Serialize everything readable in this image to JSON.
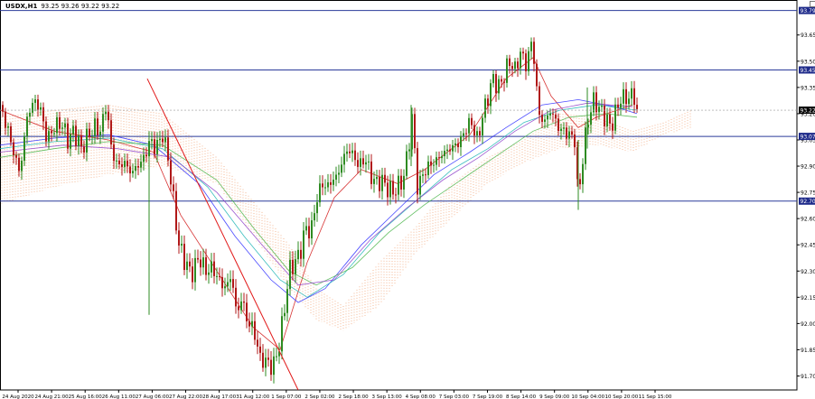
{
  "header": {
    "symbol": "USDX,H1",
    "ohlc": "93.25 93.26 93.22 93.22"
  },
  "chart_data": {
    "type": "candlestick",
    "symbol": "USDX",
    "timeframe": "H1",
    "ylim": [
      91.62,
      93.85
    ],
    "y_ticks": [
      "93.65",
      "93.50",
      "93.35",
      "93.20",
      "93.05",
      "92.90",
      "92.75",
      "92.60",
      "92.45",
      "92.30",
      "92.15",
      "92.00",
      "91.85",
      "91.70"
    ],
    "x_ticks": [
      "24 Aug 2020",
      "24 Aug 21:00",
      "25 Aug 16:00",
      "26 Aug 11:00",
      "27 Aug 06:00",
      "27 Aug 22:00",
      "28 Aug 17:00",
      "31 Aug 12:00",
      "1 Sep 07:00",
      "2 Sep 02:00",
      "2 Sep 18:00",
      "3 Sep 13:00",
      "4 Sep 08:00",
      "7 Sep 03:00",
      "7 Sep 19:00",
      "8 Sep 14:00",
      "9 Sep 09:00",
      "10 Sep 04:00",
      "10 Sep 20:00",
      "11 Sep 15:00"
    ],
    "horizontal_levels": [
      {
        "value": 93.79,
        "label": "93.79"
      },
      {
        "value": 93.45,
        "label": "93.45"
      },
      {
        "value": 93.07,
        "label": "93.07"
      },
      {
        "value": 92.7,
        "label": "92.70"
      }
    ],
    "current_price": {
      "value": 93.22,
      "label": "93.22"
    },
    "trendline": {
      "from": [
        163,
        93.4
      ],
      "to": [
        330,
        91.62
      ]
    },
    "price_path": [
      [
        0,
        93.25
      ],
      [
        8,
        93.12
      ],
      [
        15,
        92.98
      ],
      [
        22,
        92.86
      ],
      [
        30,
        93.18
      ],
      [
        38,
        93.28
      ],
      [
        45,
        93.22
      ],
      [
        52,
        93.05
      ],
      [
        60,
        93.12
      ],
      [
        68,
        93.15
      ],
      [
        75,
        93.05
      ],
      [
        82,
        93.1
      ],
      [
        90,
        93.0
      ],
      [
        98,
        93.08
      ],
      [
        105,
        93.12
      ],
      [
        112,
        93.1
      ],
      [
        118,
        93.28
      ],
      [
        122,
        93.02
      ],
      [
        130,
        92.9
      ],
      [
        138,
        92.92
      ],
      [
        145,
        92.86
      ],
      [
        152,
        92.9
      ],
      [
        160,
        92.95
      ],
      [
        166,
        93.05
      ],
      [
        172,
        93.0
      ],
      [
        180,
        93.08
      ],
      [
        186,
        92.95
      ],
      [
        192,
        92.7
      ],
      [
        198,
        92.45
      ],
      [
        205,
        92.35
      ],
      [
        212,
        92.28
      ],
      [
        220,
        92.38
      ],
      [
        228,
        92.3
      ],
      [
        235,
        92.32
      ],
      [
        242,
        92.25
      ],
      [
        250,
        92.2
      ],
      [
        256,
        92.28
      ],
      [
        262,
        92.05
      ],
      [
        268,
        92.15
      ],
      [
        274,
        92.0
      ],
      [
        280,
        91.98
      ],
      [
        288,
        91.8
      ],
      [
        295,
        91.78
      ],
      [
        302,
        91.75
      ],
      [
        308,
        91.85
      ],
      [
        314,
        92.05
      ],
      [
        320,
        92.3
      ],
      [
        326,
        92.35
      ],
      [
        332,
        92.4
      ],
      [
        338,
        92.55
      ],
      [
        344,
        92.52
      ],
      [
        350,
        92.7
      ],
      [
        356,
        92.8
      ],
      [
        362,
        92.78
      ],
      [
        368,
        92.82
      ],
      [
        374,
        92.85
      ],
      [
        380,
        92.95
      ],
      [
        386,
        93.0
      ],
      [
        392,
        92.95
      ],
      [
        398,
        92.9
      ],
      [
        404,
        92.95
      ],
      [
        410,
        92.85
      ],
      [
        416,
        92.8
      ],
      [
        422,
        92.82
      ],
      [
        428,
        92.78
      ],
      [
        434,
        92.75
      ],
      [
        440,
        92.78
      ],
      [
        446,
        92.82
      ],
      [
        452,
        93.0
      ],
      [
        456,
        93.18
      ],
      [
        462,
        92.78
      ],
      [
        468,
        92.85
      ],
      [
        474,
        92.9
      ],
      [
        480,
        92.92
      ],
      [
        486,
        92.95
      ],
      [
        492,
        92.98
      ],
      [
        498,
        93.0
      ],
      [
        504,
        93.02
      ],
      [
        510,
        93.05
      ],
      [
        516,
        93.12
      ],
      [
        522,
        93.15
      ],
      [
        528,
        93.05
      ],
      [
        534,
        93.18
      ],
      [
        540,
        93.3
      ],
      [
        546,
        93.4
      ],
      [
        552,
        93.35
      ],
      [
        558,
        93.42
      ],
      [
        564,
        93.5
      ],
      [
        570,
        93.45
      ],
      [
        576,
        93.55
      ],
      [
        582,
        93.48
      ],
      [
        588,
        93.6
      ],
      [
        592,
        93.48
      ],
      [
        596,
        93.2
      ],
      [
        602,
        93.15
      ],
      [
        610,
        93.22
      ],
      [
        618,
        93.12
      ],
      [
        624,
        93.1
      ],
      [
        630,
        93.08
      ],
      [
        636,
        93.05
      ],
      [
        640,
        92.7
      ],
      [
        646,
        93.0
      ],
      [
        652,
        93.2
      ],
      [
        658,
        93.28
      ],
      [
        664,
        93.22
      ],
      [
        670,
        93.18
      ],
      [
        676,
        93.12
      ],
      [
        682,
        93.22
      ],
      [
        688,
        93.3
      ],
      [
        694,
        93.28
      ],
      [
        700,
        93.32
      ],
      [
        705,
        93.22
      ]
    ],
    "moving_averages": [
      {
        "color": "#d01010",
        "points": [
          [
            0,
            93.22
          ],
          [
            60,
            93.1
          ],
          [
            120,
            93.05
          ],
          [
            170,
            92.98
          ],
          [
            200,
            92.62
          ],
          [
            240,
            92.3
          ],
          [
            280,
            91.98
          ],
          [
            310,
            91.85
          ],
          [
            340,
            92.35
          ],
          [
            370,
            92.72
          ],
          [
            400,
            92.88
          ],
          [
            440,
            92.8
          ],
          [
            470,
            92.88
          ],
          [
            520,
            93.08
          ],
          [
            560,
            93.4
          ],
          [
            590,
            93.52
          ],
          [
            610,
            93.3
          ],
          [
            640,
            93.12
          ],
          [
            660,
            93.18
          ],
          [
            700,
            93.25
          ]
        ]
      },
      {
        "color": "#2a2aff",
        "points": [
          [
            0,
            93.02
          ],
          [
            60,
            93.06
          ],
          [
            120,
            93.08
          ],
          [
            170,
            93.02
          ],
          [
            220,
            92.8
          ],
          [
            260,
            92.5
          ],
          [
            300,
            92.25
          ],
          [
            330,
            92.12
          ],
          [
            360,
            92.2
          ],
          [
            400,
            92.45
          ],
          [
            440,
            92.65
          ],
          [
            480,
            92.85
          ],
          [
            520,
            92.98
          ],
          [
            560,
            93.12
          ],
          [
            600,
            93.25
          ],
          [
            640,
            93.28
          ],
          [
            680,
            93.24
          ],
          [
            705,
            93.2
          ]
        ]
      },
      {
        "color": "#17b3b3",
        "points": [
          [
            0,
            93.0
          ],
          [
            60,
            93.04
          ],
          [
            120,
            93.06
          ],
          [
            180,
            93.0
          ],
          [
            230,
            92.78
          ],
          [
            270,
            92.5
          ],
          [
            310,
            92.25
          ],
          [
            340,
            92.15
          ],
          [
            380,
            92.28
          ],
          [
            420,
            92.52
          ],
          [
            460,
            92.7
          ],
          [
            500,
            92.88
          ],
          [
            540,
            93.0
          ],
          [
            580,
            93.15
          ],
          [
            620,
            93.22
          ],
          [
            660,
            93.25
          ],
          [
            705,
            93.22
          ]
        ]
      },
      {
        "color": "#46b446",
        "points": [
          [
            0,
            92.95
          ],
          [
            60,
            93.0
          ],
          [
            120,
            93.04
          ],
          [
            180,
            93.02
          ],
          [
            240,
            92.82
          ],
          [
            280,
            92.55
          ],
          [
            320,
            92.3
          ],
          [
            350,
            92.22
          ],
          [
            390,
            92.32
          ],
          [
            430,
            92.52
          ],
          [
            470,
            92.68
          ],
          [
            510,
            92.82
          ],
          [
            550,
            92.96
          ],
          [
            590,
            93.1
          ],
          [
            630,
            93.18
          ],
          [
            670,
            93.2
          ],
          [
            705,
            93.18
          ]
        ]
      },
      {
        "color": "#8c3cc8",
        "points": [
          [
            0,
            92.98
          ],
          [
            70,
            93.02
          ],
          [
            130,
            93.0
          ],
          [
            190,
            92.95
          ],
          [
            240,
            92.75
          ],
          [
            290,
            92.45
          ],
          [
            330,
            92.22
          ],
          [
            370,
            92.25
          ],
          [
            410,
            92.48
          ],
          [
            450,
            92.66
          ],
          [
            490,
            92.82
          ],
          [
            530,
            92.95
          ],
          [
            570,
            93.1
          ],
          [
            610,
            93.22
          ],
          [
            650,
            93.26
          ],
          [
            700,
            93.24
          ]
        ]
      }
    ],
    "cloud_upper": [
      [
        0,
        93.18
      ],
      [
        60,
        93.22
      ],
      [
        120,
        93.25
      ],
      [
        180,
        93.2
      ],
      [
        240,
        92.95
      ],
      [
        280,
        92.7
      ],
      [
        320,
        92.45
      ],
      [
        350,
        92.2
      ],
      [
        380,
        92.1
      ],
      [
        420,
        92.35
      ],
      [
        460,
        92.55
      ],
      [
        500,
        92.8
      ],
      [
        540,
        92.95
      ],
      [
        580,
        93.05
      ],
      [
        620,
        93.2
      ],
      [
        660,
        93.18
      ],
      [
        700,
        93.1
      ],
      [
        735,
        93.15
      ],
      [
        765,
        93.22
      ]
    ],
    "cloud_lower": [
      [
        0,
        92.68
      ],
      [
        60,
        92.78
      ],
      [
        120,
        92.85
      ],
      [
        180,
        92.9
      ],
      [
        240,
        92.8
      ],
      [
        280,
        92.5
      ],
      [
        320,
        92.2
      ],
      [
        350,
        92.02
      ],
      [
        380,
        91.96
      ],
      [
        420,
        92.1
      ],
      [
        460,
        92.4
      ],
      [
        500,
        92.6
      ],
      [
        540,
        92.8
      ],
      [
        580,
        92.92
      ],
      [
        620,
        93.0
      ],
      [
        660,
        93.02
      ],
      [
        700,
        92.98
      ],
      [
        735,
        93.08
      ],
      [
        765,
        93.12
      ]
    ]
  },
  "colors": {
    "bull": "#2e8b22",
    "bear": "#b01818",
    "hline": "#2a3a9a",
    "trend": "#e11919",
    "cloud": "#f0a070",
    "badge": "#1e2a8a",
    "badge_text": "#ffffff",
    "axis": "#000000"
  }
}
